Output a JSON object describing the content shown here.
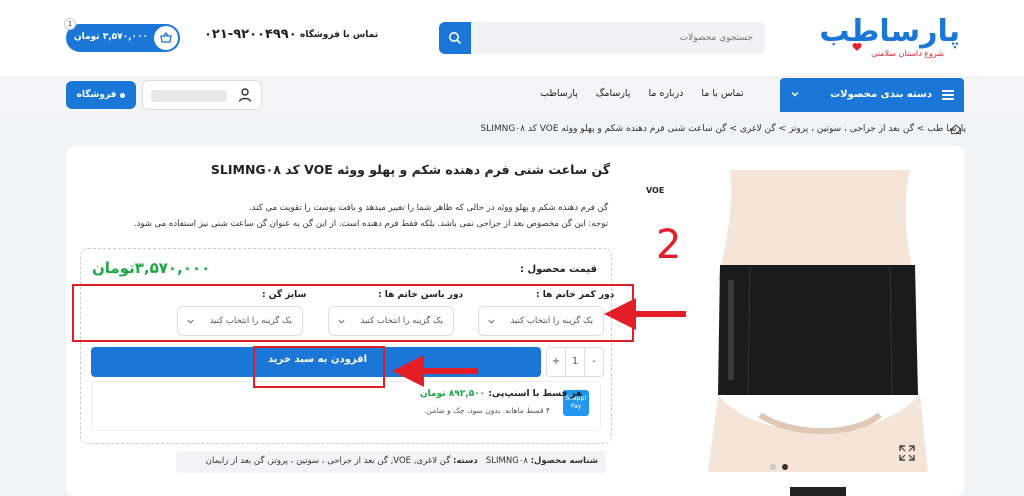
{
  "header": {
    "logo_main": "پارساطب",
    "logo_sub": "شروع داستان سلامتی",
    "search_placeholder": "جستجوی محصولات",
    "contact_label": "تماس با فروشگاه",
    "contact_phone": "۰۲۱-۹۲۰۰۴۹۹۰",
    "cart_total": "۳,۵۷۰,۰۰۰ تومان",
    "cart_count": "1"
  },
  "nav": {
    "categories_label": "دسته بندی محصولات",
    "links": [
      "پارساطب",
      "پارسامگ",
      "درباره ما",
      "تماس با ما"
    ],
    "shop_label": "فروشگاه"
  },
  "breadcrumb": "پارسا طب > گن بعد از جراحی ، سوتین ، پروتز > گن لاغری > گن ساعت شنی فرم دهنده شکم و پهلو ووئه VOE کد SLIMNG۰۸",
  "product": {
    "title": "گن ساعت شنی فرم دهنده شکم و پهلو ووئه VOE کد SLIMNG۰۸",
    "desc_line1": "گن فرم دهنده شکم و پهلو ووئه در حالی که ظاهر شما را تغییر میدهد و بافت پوست را تقویت می کند.",
    "desc_line2": "توجه: این گن مخصوص بعد از جراحی نمی باشد. بلکه فقط فرم دهنده است. از این گن به عنوان گن ساعت شنی نیز استفاده می شود.",
    "price_label": "قیمت محصول :",
    "price_value": "۳,۵۷۰,۰۰۰تومان",
    "brand": "VOE",
    "options": [
      {
        "label": "دور کمر خانم ها :",
        "placeholder": "یک گزینه را انتخاب کنید"
      },
      {
        "label": "دور باسن خانم ها :",
        "placeholder": "یک گزینه را انتخاب کنید"
      },
      {
        "label": "سایز گن :",
        "placeholder": "یک گزینه را انتخاب کنید"
      }
    ],
    "qty": {
      "minus": "-",
      "value": "1",
      "plus": "+"
    },
    "add_to_cart": "افزودن به سبد خرید",
    "snapp": {
      "logo": "Snapp! Pay",
      "line1_prefix": "هر قسط با اسنپ‌پی:",
      "line1_amount": "۸۹۲,۵۰۰ تومان",
      "line2": "۴ قسط ماهانه. بدون سود، چک و ضامن."
    },
    "meta": {
      "sku_label": "شناسه محصول:",
      "sku": "SLIMNG۰۸",
      "cat_label": "دسته:",
      "categories": "گن لاغری, VOE, گن بعد از جراحی ، سوتین ، پروتز, گن بعد از زایمان"
    }
  },
  "annotation": {
    "number": "2"
  },
  "colors": {
    "primary": "#1a77d8",
    "price": "#1ba83e",
    "annotation": "#e41e26"
  }
}
